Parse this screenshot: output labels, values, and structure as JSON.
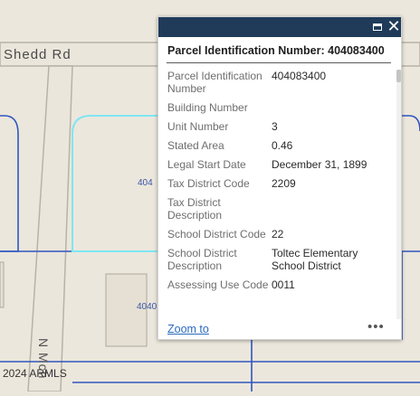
{
  "map": {
    "road_labels": {
      "shedd": "Shedd Rd",
      "vertical": "N Mch"
    },
    "parcel_labels": {
      "upper": "404",
      "lower": "4040"
    },
    "attribution": "2024 ARMLS"
  },
  "colors": {
    "map_background": "#ece7dc",
    "road_fill": "#ebe6dc",
    "road_edge": "#b8b2a6",
    "parcel_line": "#2f56c0",
    "highlight": "#7fe6f2",
    "popup_header": "#1f3b59",
    "link": "#2a6ac0"
  },
  "popup": {
    "title": "Parcel Identification Number: 404083400",
    "header_icons": {
      "maximize": "maximize-icon",
      "close": "close-icon",
      "close_glyph": "✕"
    },
    "fields": [
      {
        "label": "Parcel Identification Number",
        "value": "404083400"
      },
      {
        "label": "Building Number",
        "value": ""
      },
      {
        "label": "Unit Number",
        "value": "3"
      },
      {
        "label": "Stated Area",
        "value": "0.46"
      },
      {
        "label": "Legal Start Date",
        "value": "December 31, 1899"
      },
      {
        "label": "Tax District Code",
        "value": "2209"
      },
      {
        "label": "Tax District Description",
        "value": ""
      },
      {
        "label": "School District Code",
        "value": "22"
      },
      {
        "label": "School District Description",
        "value": "Toltec Elementary School District"
      },
      {
        "label": "Assessing Use Code",
        "value": "0011"
      }
    ],
    "zoom_label": "Zoom to",
    "more_label": "•••"
  }
}
